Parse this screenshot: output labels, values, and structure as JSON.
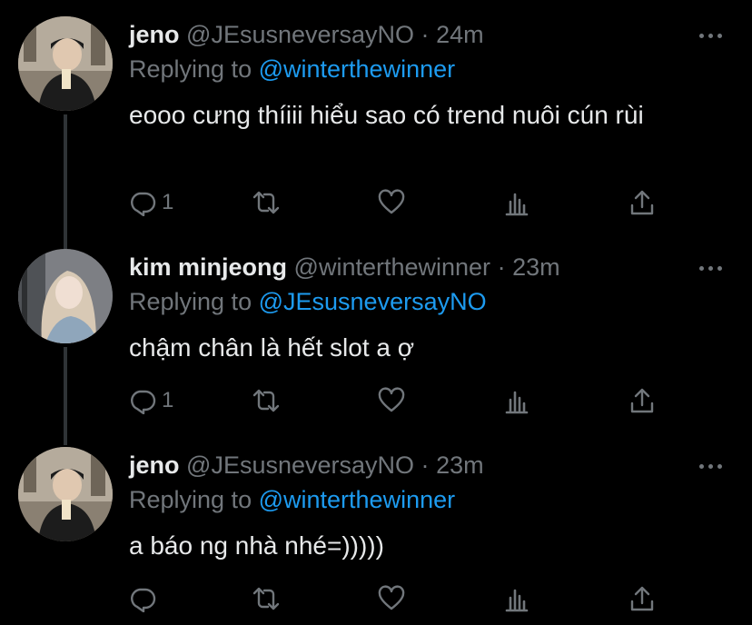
{
  "tweets": [
    {
      "name": "jeno",
      "handle": "@JEsusneversayNO",
      "separator": "·",
      "time": "24m",
      "replying_prefix": "Replying to",
      "replying_to": "@winterthewinner",
      "text": "eooo cưng thíiii hiểu sao có trend nuôi cún rùi",
      "reply_count": "1"
    },
    {
      "name": "kim minjeong",
      "handle": "@winterthewinner",
      "separator": "·",
      "time": "23m",
      "replying_prefix": "Replying to",
      "replying_to": "@JEsusneversayNO",
      "text": "chậm chân là hết slot a ợ",
      "reply_count": "1"
    },
    {
      "name": "jeno",
      "handle": "@JEsusneversayNO",
      "separator": "·",
      "time": "23m",
      "replying_prefix": "Replying to",
      "replying_to": "@winterthewinner",
      "text": "a báo ng nhà nhé=)))))",
      "reply_count": ""
    }
  ],
  "icons": {
    "reply": "reply-icon",
    "retweet": "retweet-icon",
    "like": "heart-icon",
    "analytics": "analytics-icon",
    "share": "share-icon",
    "more": "more-icon"
  },
  "colors": {
    "background": "#000000",
    "text": "#e7e9ea",
    "muted": "#71767b",
    "accent": "#1d9bf0",
    "thread_line": "#2f3336"
  }
}
